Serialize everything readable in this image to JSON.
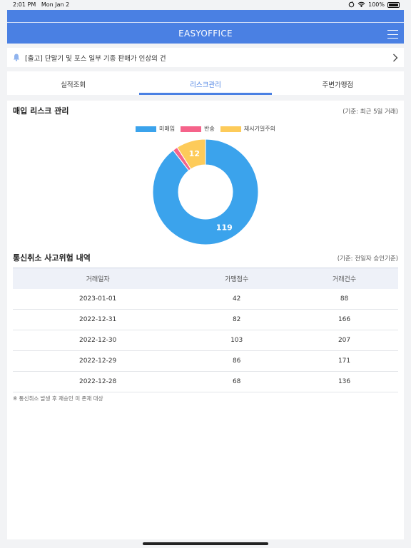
{
  "status_bar": {
    "time": "2:01 PM",
    "date": "Mon Jan 2",
    "battery": "100%"
  },
  "header": {
    "title": "EASYOFFICE"
  },
  "notice": {
    "text": "[출고] 단말기 및 포스 일부 기종 판매가 인상의 건"
  },
  "tabs": [
    {
      "label": "실적조회",
      "active": false
    },
    {
      "label": "리스크관리",
      "active": true
    },
    {
      "label": "주변가맹점",
      "active": false
    }
  ],
  "risk": {
    "title": "매입 리스크 관리",
    "note": "(기준: 최근 5일 거래)"
  },
  "chart_data": {
    "type": "pie",
    "donut": true,
    "legend_position": "top-center",
    "categories": [
      "미매입",
      "반송",
      "제시기일주의"
    ],
    "values": [
      119,
      2,
      12
    ],
    "data_labels": [
      "119",
      "",
      "12"
    ],
    "colors": [
      "#3ba3ec",
      "#f5638a",
      "#fdcb5a"
    ]
  },
  "cancel": {
    "title": "통신취소 사고위험 내역",
    "note": "(기준: 전일자 승인기준)",
    "columns": [
      "거래일자",
      "가맹점수",
      "거래건수"
    ],
    "rows": [
      [
        "2023-01-01",
        "42",
        "88"
      ],
      [
        "2022-12-31",
        "82",
        "166"
      ],
      [
        "2022-12-30",
        "103",
        "207"
      ],
      [
        "2022-12-29",
        "86",
        "171"
      ],
      [
        "2022-12-28",
        "68",
        "136"
      ]
    ],
    "footnote": "※ 통신취소 발생 후 재승인 미 존재 대상"
  }
}
